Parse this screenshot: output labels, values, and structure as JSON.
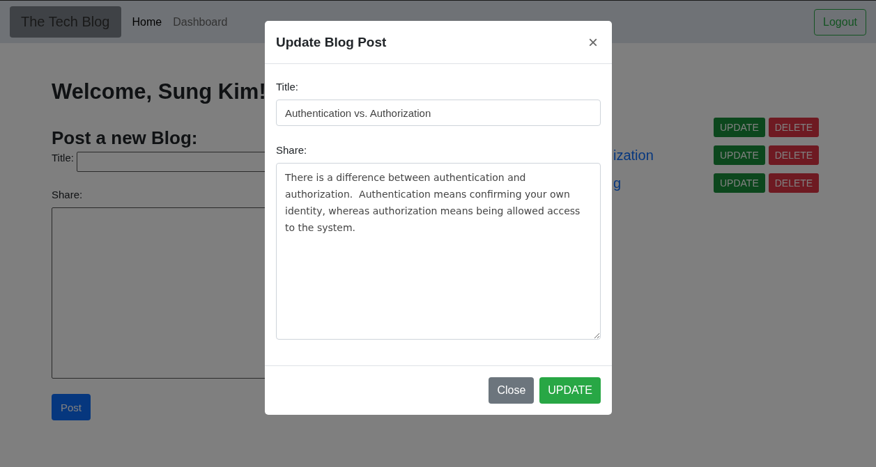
{
  "navbar": {
    "brand": "The Tech Blog",
    "links": [
      {
        "label": "Home",
        "selected": true
      },
      {
        "label": "Dashboard",
        "selected": false
      }
    ],
    "logout": "Logout"
  },
  "welcome": "Welcome, Sung Kim!",
  "new_post": {
    "heading": "Post a new Blog:",
    "title_label": "Title:",
    "share_label": "Share:",
    "button": "Post"
  },
  "posts": [
    {
      "update": "UPDATE",
      "delete": "DELETE"
    },
    {
      "title": "ization",
      "update": "UPDATE",
      "delete": "DELETE"
    },
    {
      "title": "g",
      "update": "UPDATE",
      "delete": "DELETE"
    }
  ],
  "modal": {
    "title": "Update Blog Post",
    "close_icon": "×",
    "title_label": "Title:",
    "title_value": "Authentication vs. Authorization",
    "share_label": "Share:",
    "share_value": "There is a difference between authentication and authorization.  Authentication means confirming your own identity, whereas authorization means being allowed access to the system.",
    "buttons": [
      {
        "label": "Close",
        "kind": "secondary"
      },
      {
        "label": "UPDATE",
        "kind": "success"
      }
    ]
  }
}
